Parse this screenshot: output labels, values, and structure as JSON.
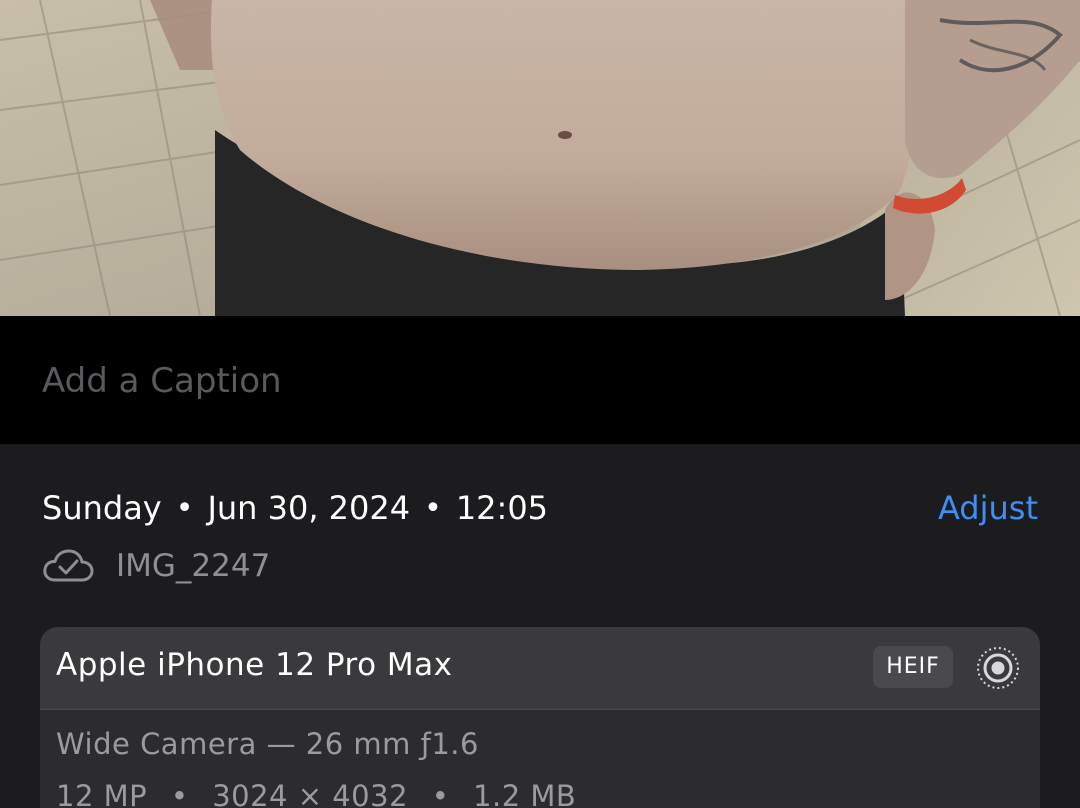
{
  "caption": {
    "placeholder": "Add a Caption"
  },
  "info": {
    "day": "Sunday",
    "date": "Jun 30, 2024",
    "time": "12:05",
    "separator": "•",
    "adjust_label": "Adjust",
    "cloud_icon": "icloud-checkmark-icon",
    "filename": "IMG_2247"
  },
  "camera": {
    "model": "Apple iPhone 12 Pro Max",
    "format": "HEIF",
    "live_photo_icon": "live-photo-icon",
    "lens": "Wide Camera — 26 mm ƒ1.6",
    "megapixels": "12 MP",
    "resolution": "3024 × 4032",
    "file_size": "1.2 MB",
    "spec_separator": "•"
  },
  "colors": {
    "accent": "#3e8ef7",
    "panel": "#1c1c1e",
    "card": "#2c2c2e",
    "card_header": "#3a3a3c",
    "secondary_text": "#8e8e93"
  }
}
